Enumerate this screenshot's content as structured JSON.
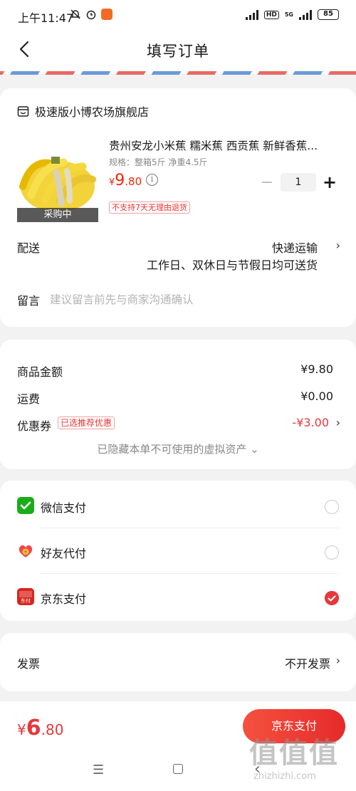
{
  "status_bar": {
    "time": "上午11:47",
    "network": "5G",
    "hd_badge": "HD",
    "battery": "85"
  },
  "header": {
    "title": "填写订单"
  },
  "store": {
    "name": "极速版小博农场旗舰店"
  },
  "product": {
    "name": "贵州安龙小米蕉 糯米蕉 西贡蕉 新鲜香蕉...",
    "spec": "规格：整箱5斤  净重4.5斤",
    "price_currency": "¥",
    "price_int": "9",
    "price_dec": ".80",
    "badge": "采购中",
    "quantity": "1",
    "minus": "−",
    "plus": "+",
    "return_policy": "不支持7天无理由退货"
  },
  "delivery": {
    "label": "配送",
    "method": "快递运输",
    "note": "工作日、双休日与节假日均可送货"
  },
  "memo": {
    "label": "留言",
    "placeholder": "建议留言前先与商家沟通确认"
  },
  "amounts": {
    "goods_label": "商品金额",
    "goods_value": "¥9.80",
    "freight_label": "运费",
    "freight_value": "¥0.00",
    "coupon_label": "优惠券",
    "coupon_tag": "已选推荐优惠",
    "coupon_value": "-¥3.00",
    "hidden_note": "已隐藏本单不可使用的虚拟资产 ⌄"
  },
  "payment": {
    "methods": [
      {
        "label": "微信支付",
        "selected": false
      },
      {
        "label": "好友代付",
        "selected": false
      },
      {
        "label": "京东支付",
        "selected": true
      }
    ]
  },
  "invoice": {
    "label": "发票",
    "value": "不开发票"
  },
  "footer": {
    "total_currency": "¥",
    "total_int": "6",
    "total_dec": ".80",
    "pay_button": "京东支付"
  },
  "watermark": {
    "big": "值值值",
    "small": "zhizhizhi.com"
  },
  "colors": {
    "accent": "#e4393c",
    "price": "#f2270c",
    "wechat": "#1aad19"
  }
}
